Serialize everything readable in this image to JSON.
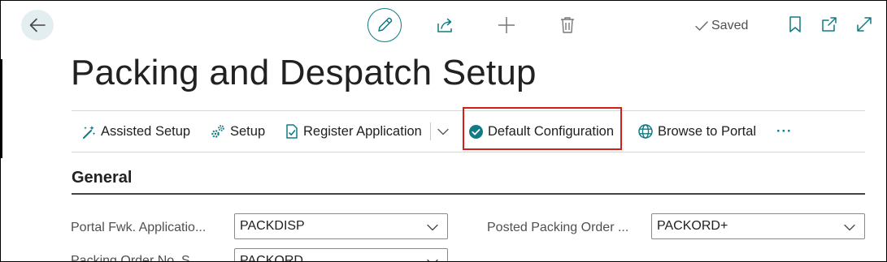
{
  "topbar": {
    "saved_label": "Saved"
  },
  "page": {
    "title": "Packing and Despatch Setup"
  },
  "actions": {
    "assisted_setup": "Assisted Setup",
    "setup": "Setup",
    "register_application": "Register Application",
    "default_configuration": "Default Configuration",
    "browse_to_portal": "Browse to Portal",
    "more": "···"
  },
  "general": {
    "title": "General",
    "fields": [
      {
        "label": "Portal Fwk. Applicatio...",
        "value": "PACKDISP"
      },
      {
        "label": "Posted Packing Order ...",
        "value": "PACKORD+"
      },
      {
        "label": "Packing Order No. S...",
        "value": "PACKORD"
      }
    ]
  },
  "colors": {
    "accent": "#0f7b84",
    "highlight": "#d0201c"
  }
}
